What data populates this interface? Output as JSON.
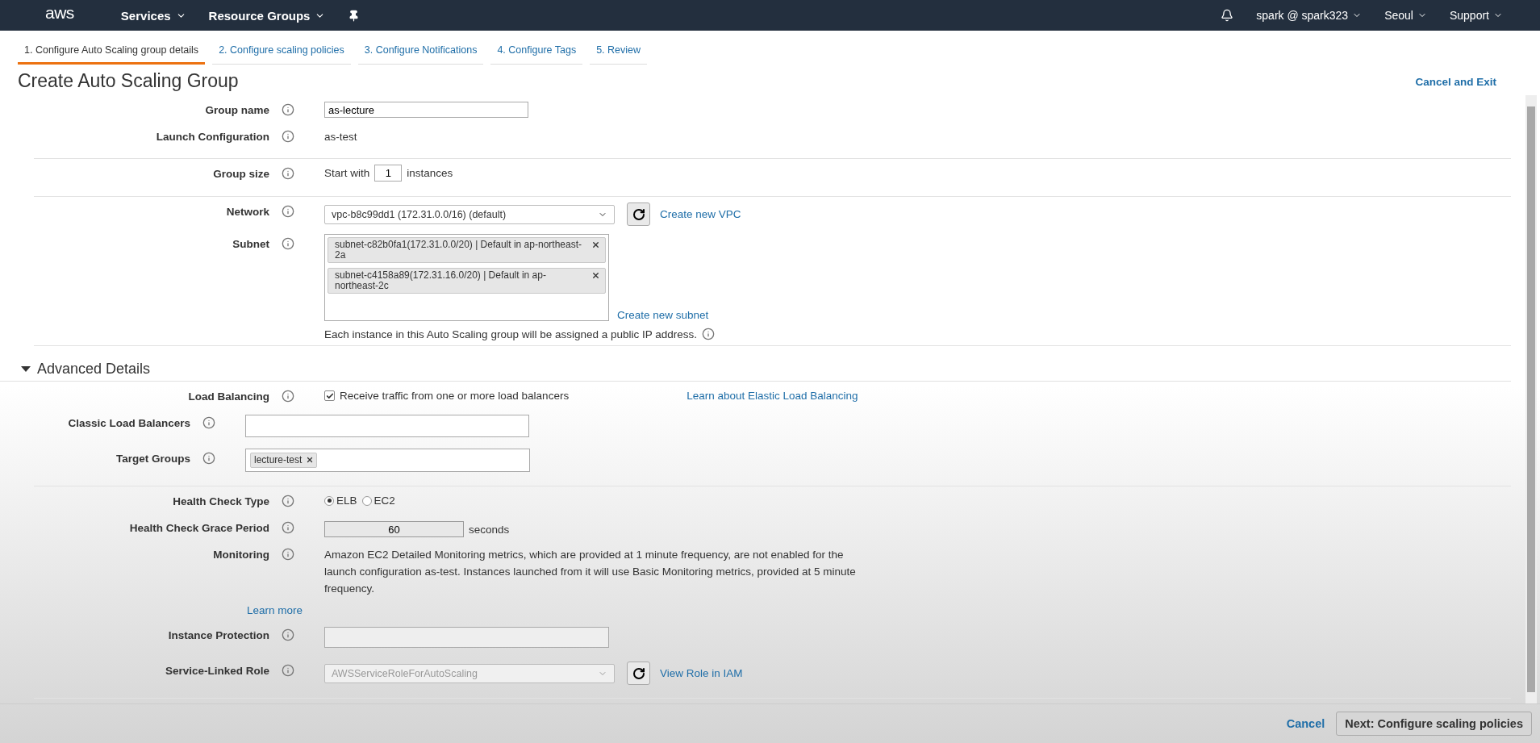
{
  "nav": {
    "logo": "aws",
    "menus": [
      {
        "label": "Services"
      },
      {
        "label": "Resource Groups"
      }
    ],
    "right": [
      {
        "label": "spark @ spark323"
      },
      {
        "label": "Seoul"
      },
      {
        "label": "Support"
      }
    ]
  },
  "steps": [
    {
      "label": "1. Configure Auto Scaling group details",
      "selected": true
    },
    {
      "label": "2. Configure scaling policies",
      "selected": false
    },
    {
      "label": "3. Configure Notifications",
      "selected": false
    },
    {
      "label": "4. Configure Tags",
      "selected": false
    },
    {
      "label": "5. Review",
      "selected": false
    }
  ],
  "title": "Create Auto Scaling Group",
  "cancel_exit": "Cancel and Exit",
  "groups": [
    [
      {
        "kind": "input",
        "label": "Group name",
        "value": "as-lecture"
      },
      {
        "kind": "text",
        "label": "Launch Configuration",
        "value": "as-test"
      }
    ],
    [
      {
        "kind": "count",
        "label": "Group size",
        "prefix": "Start with",
        "value": "1",
        "suffix": "instances"
      }
    ],
    [
      {
        "kind": "select",
        "label": "Network",
        "value": "vpc-b8c99dd1 (172.31.0.0/16) (default)",
        "link": "Create new VPC",
        "disabled": false
      },
      {
        "kind": "subnet",
        "label": "Subnet",
        "tags": [
          "subnet-c82b0fa1(172.31.0.0/20) | Default in ap-northeast-2a",
          "subnet-c4158a89(172.31.16.0/20) | Default in ap-northeast-2c"
        ],
        "link": "Create new subnet",
        "note": "Each instance in this Auto Scaling group will be assigned a public IP address."
      }
    ]
  ],
  "advanced": {
    "title": "Advanced Details",
    "expanded": true,
    "groups": [
      [
        {
          "kind": "checkbox",
          "label": "Load Balancing",
          "text": "Receive traffic from one or more load balancers",
          "checked": true,
          "link": "Learn about Elastic Load Balancing"
        },
        {
          "kind": "wide_input",
          "label": "Classic Load Balancers"
        },
        {
          "kind": "wide_tags",
          "label": "Target Groups",
          "tags": [
            "lecture-test"
          ]
        }
      ],
      [
        {
          "kind": "radio",
          "label": "Health Check Type",
          "options": [
            {
              "label": "ELB",
              "selected": true
            },
            {
              "label": "EC2",
              "selected": false
            }
          ]
        },
        {
          "kind": "numeric",
          "label": "Health Check Grace Period",
          "value": "60",
          "suffix": "seconds"
        },
        {
          "kind": "paragraph",
          "label": "Monitoring",
          "text": "Amazon EC2 Detailed Monitoring metrics, which are provided at 1 minute frequency, are not enabled for the launch configuration as-test. Instances launched from it will use Basic Monitoring metrics, provided at 5 minute frequency.",
          "link": "Learn more"
        },
        {
          "kind": "blank_input",
          "label": "Instance Protection"
        },
        {
          "kind": "select",
          "label": "Service-Linked Role",
          "value": "AWSServiceRoleForAutoScaling",
          "link": "View Role in IAM",
          "disabled": true
        }
      ]
    ]
  },
  "footer": {
    "cancel": "Cancel",
    "next": "Next: Configure scaling policies"
  }
}
